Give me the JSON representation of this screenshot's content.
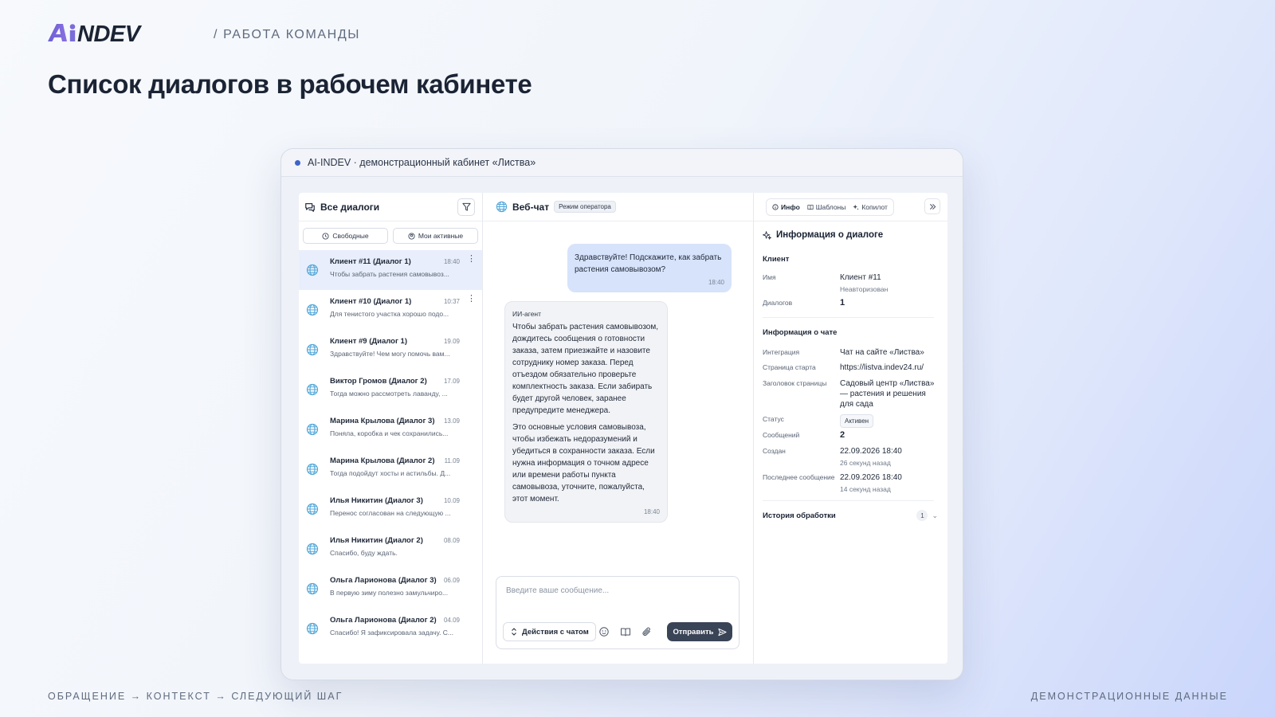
{
  "header": {
    "logo_text": "AiNDEV",
    "section": "/ РАБОТА КОМАНДЫ",
    "title": "Список диалогов в рабочем кабинете"
  },
  "footer": {
    "left": "ОБРАЩЕНИЕ → КОНТЕКСТ → СЛЕДУЮЩИЙ ШАГ",
    "right": "ДЕМОНСТРАЦИОННЫЕ ДАННЫЕ"
  },
  "window": {
    "title": "AI-INDEV · демонстрационный кабинет «Листва»"
  },
  "dialogs": {
    "title": "Все диалоги",
    "filters": [
      "Свободные",
      "Мои активные"
    ],
    "items": [
      {
        "name": "Клиент #11 (Диалог 1)",
        "time": "18:40",
        "preview": "Чтобы забрать растения самовывоз...",
        "active": true,
        "menu": true
      },
      {
        "name": "Клиент #10 (Диалог 1)",
        "time": "10:37",
        "preview": "Для тенистого участка хорошо подо...",
        "menu": true
      },
      {
        "name": "Клиент #9 (Диалог 1)",
        "time": "19.09",
        "preview": "Здравствуйте! Чем могу помочь вам..."
      },
      {
        "name": "Виктор Громов (Диалог 2)",
        "time": "17.09",
        "preview": "Тогда можно рассмотреть лаванду, ..."
      },
      {
        "name": "Марина Крылова (Диалог 3)",
        "time": "13.09",
        "preview": "Поняла, коробка и чек сохранились..."
      },
      {
        "name": "Марина Крылова (Диалог 2)",
        "time": "11.09",
        "preview": "Тогда подойдут хосты и астильбы. Д..."
      },
      {
        "name": "Илья Никитин (Диалог 3)",
        "time": "10.09",
        "preview": "Перенос согласован на следующую ..."
      },
      {
        "name": "Илья Никитин (Диалог 2)",
        "time": "08.09",
        "preview": "Спасибо, буду ждать."
      },
      {
        "name": "Ольга Ларионова (Диалог 3)",
        "time": "06.09",
        "preview": "В первую зиму полезно замульчиро..."
      },
      {
        "name": "Ольга Ларионова (Диалог 2)",
        "time": "04.09",
        "preview": "Спасибо! Я зафиксировала задачу. С..."
      }
    ]
  },
  "chat": {
    "title": "Веб-чат",
    "mode": "Режим оператора",
    "user_message": {
      "text": "Здравствуйте! Подскажите, как забрать растения самовывозом?",
      "time": "18:40"
    },
    "agent_message": {
      "author": "ИИ-агент",
      "paragraph1": "Чтобы забрать растения самовывозом, дождитесь сообщения о готовности заказа, затем приезжайте и назовите сотруднику номер заказа. Перед отъездом обязательно проверьте комплектность заказа. Если забирать будет другой человек, заранее предупредите менеджера.",
      "paragraph2": "Это основные условия самовывоза, чтобы избежать недоразумений и убедиться в сохранности заказа. Если нужна информация о точном адресе или времени работы пункта самовывоза, уточните, пожалуйста, этот момент.",
      "time": "18:40"
    },
    "composer": {
      "placeholder": "Введите ваше сообщение...",
      "actions_label": "Действия с чатом",
      "send_label": "Отправить"
    }
  },
  "info": {
    "tabs": [
      "Инфо",
      "Шаблоны",
      "Копилот"
    ],
    "title": "Информация о диалоге",
    "client_section": "Клиент",
    "name_label": "Имя",
    "name_value": "Клиент #11",
    "name_sub": "Неавторизован",
    "dialogs_label": "Диалогов",
    "dialogs_value": "1",
    "chat_section": "Информация о чате",
    "integration_label": "Интеграция",
    "integration_value": "Чат на сайте «Листва»",
    "start_page_label": "Страница старта",
    "start_page_value": "https://listva.indev24.ru/",
    "page_title_label": "Заголовок страницы",
    "page_title_value": "Садовый центр «Листва» — растения и решения для сада",
    "status_label": "Статус",
    "status_value": "Активен",
    "messages_label": "Сообщений",
    "messages_value": "2",
    "created_label": "Создан",
    "created_value": "22.09.2026 18:40",
    "created_sub": "26 секунд назад",
    "last_label": "Последнее сообщение",
    "last_value": "22.09.2026 18:40",
    "last_sub": "14 секунд назад",
    "history_label": "История обработки",
    "history_count": "1"
  },
  "colors": {
    "accent": "#3f63c8",
    "logo_a": "#6b5fd6",
    "logo_text": "#1b2434",
    "send_button": "#3a4457",
    "user_bubble": "#d7e3fb",
    "active_row": "#e8eefb",
    "globe": "#53a7d8"
  }
}
